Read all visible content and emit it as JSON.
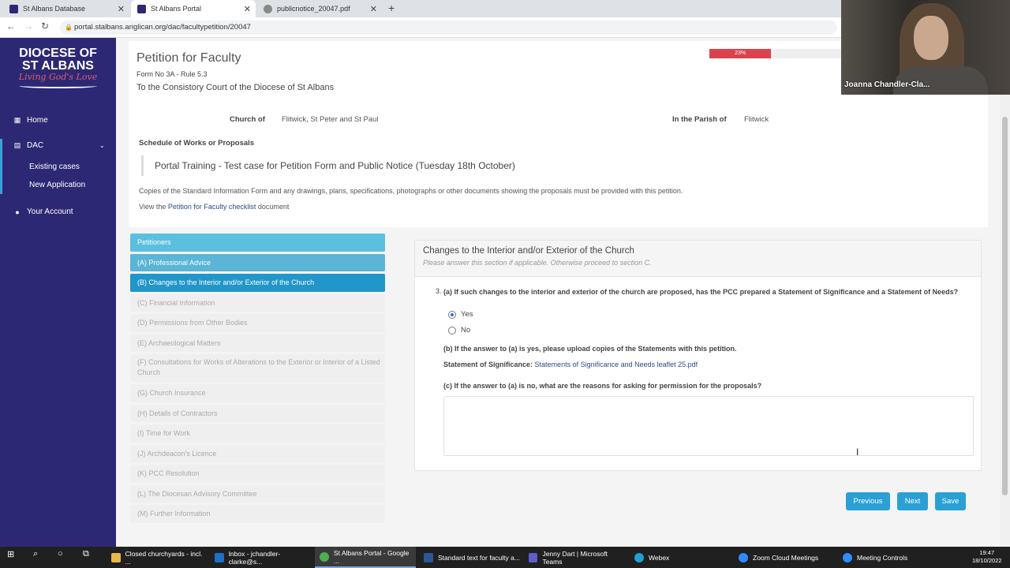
{
  "browser": {
    "tabs": [
      {
        "label": "St Albans Database"
      },
      {
        "label": "St Albans Portal"
      },
      {
        "label": "publicnotice_20047.pdf"
      }
    ],
    "url": "portal.stalbans.anglican.org/dac/facultypetition/20047"
  },
  "sidebar": {
    "logo": {
      "line1": "DIOCESE OF",
      "line2": "ST ALBANS",
      "tagline": "Living God's Love"
    },
    "items": [
      {
        "label": "Home"
      },
      {
        "label": "DAC"
      },
      {
        "label": "Existing cases"
      },
      {
        "label": "New Application"
      },
      {
        "label": "Your Account"
      }
    ]
  },
  "webcam": {
    "name": "Joanna Chandler-Cla..."
  },
  "header": {
    "title": "Petition for Faculty",
    "form": "Form No 3A - Rule 5.3",
    "court": "To the Consistory Court of the Diocese of St Albans",
    "progress_label": "23%",
    "progress_value": 0.23
  },
  "info": {
    "church_label": "Church of",
    "church_value": "Flitwick, St Peter and St Paul",
    "parish_label": "In the Parish of",
    "parish_value": "Flitwick",
    "schedule_label": "Schedule of Works or Proposals",
    "schedule_value": "Portal Training - Test case for Petition Form and Public Notice (Tuesday 18th October)",
    "copies_text": "Copies of the Standard Information Form and any drawings, plans, specifications, photographs or other documents showing the proposals must be provided with this petition.",
    "view_prefix": "View the ",
    "view_link": "Petition for Faculty checklist",
    "view_suffix": " document"
  },
  "steps": [
    {
      "label": "Petitioners"
    },
    {
      "label": "(A) Professional Advice"
    },
    {
      "label": "(B) Changes to the Interior and/or Exterior of the Church"
    },
    {
      "label": "(C) Financial Information"
    },
    {
      "label": "(D) Permissions from Other Bodies"
    },
    {
      "label": "(E) Archaeological Matters"
    },
    {
      "label": "(F) Consultations for Works of Alterations to the Exterior or Interior of a Listed Church"
    },
    {
      "label": "(G) Church Insurance"
    },
    {
      "label": "(H) Details of Contractors"
    },
    {
      "label": "(I) Time for Work"
    },
    {
      "label": "(J) Archdeacon's Licence"
    },
    {
      "label": "(K) PCC Resolution"
    },
    {
      "label": "(L) The Diocesan Advisory Committee"
    },
    {
      "label": "(M) Further Information"
    }
  ],
  "panel": {
    "title": "Changes to the Interior and/or Exterior of the Church",
    "subtitle": "Please answer this section if applicable. Otherwise proceed to section C.",
    "q_num": "3.",
    "q_a": "(a) If such changes to the interior and exterior of the church are proposed, has the PCC prepared a Statement of Significance and a Statement of Needs?",
    "yes": "Yes",
    "no": "No",
    "q_b": "(b) If the answer to (a) is yes, please upload copies of the Statements with this petition.",
    "sos_label": "Statement of Significance:",
    "sos_file": "Statements of Significance and Needs leaflet 25.pdf",
    "q_c": "(c) If the answer to (a) is no, what are the reasons for asking for permission for the proposals?"
  },
  "buttons": {
    "previous": "Previous",
    "next": "Next",
    "save": "Save"
  },
  "taskbar": {
    "items": [
      {
        "label": "Closed churchyards - incl. ..."
      },
      {
        "label": "Inbox - jchandler-clarke@s..."
      },
      {
        "label": "St Albans Portal - Google ..."
      },
      {
        "label": "Standard text for faculty a..."
      },
      {
        "label": "Jenny Dart | Microsoft Teams"
      },
      {
        "label": "Webex"
      },
      {
        "label": "Zoom Cloud Meetings"
      },
      {
        "label": "Meeting Controls"
      }
    ],
    "time": "19:47",
    "date": "18/10/2022"
  }
}
